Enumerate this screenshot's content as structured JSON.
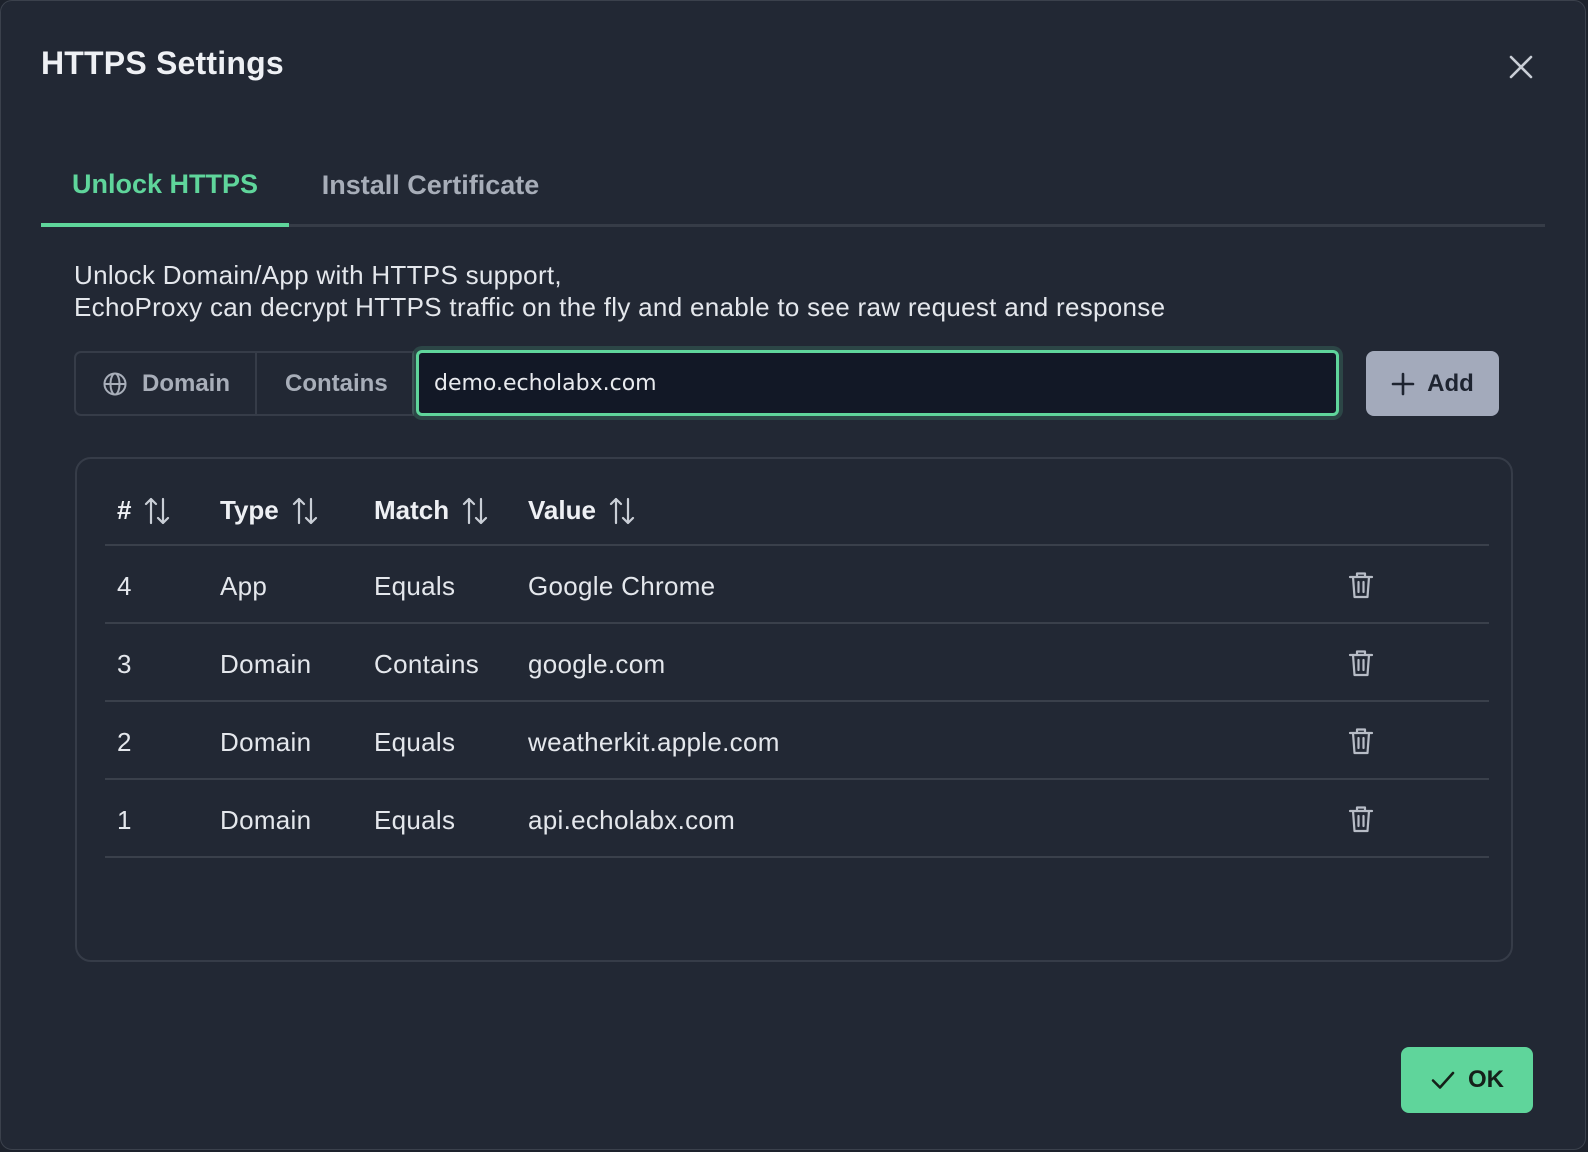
{
  "dialog": {
    "title": "HTTPS Settings"
  },
  "tabs": [
    {
      "label": "Unlock HTTPS",
      "active": true
    },
    {
      "label": "Install Certificate",
      "active": false
    }
  ],
  "description": {
    "line1": "Unlock Domain/App with HTTPS support,",
    "line2": "EchoProxy can decrypt HTTPS traffic on the fly and enable to see raw request and response"
  },
  "filter": {
    "type_label": "Domain",
    "match_label": "Contains",
    "value": "demo.echolabx.com",
    "add_label": "Add"
  },
  "table": {
    "columns": [
      "#",
      "Type",
      "Match",
      "Value"
    ],
    "rows": [
      {
        "id": "4",
        "type": "App",
        "match": "Equals",
        "value": "Google Chrome"
      },
      {
        "id": "3",
        "type": "Domain",
        "match": "Contains",
        "value": "google.com"
      },
      {
        "id": "2",
        "type": "Domain",
        "match": "Equals",
        "value": "weatherkit.apple.com"
      },
      {
        "id": "1",
        "type": "Domain",
        "match": "Equals",
        "value": "api.echolabx.com"
      }
    ]
  },
  "footer": {
    "ok_label": "OK"
  },
  "colors": {
    "accent": "#5fd59b",
    "background": "#222834",
    "add_button": "#a3aabb"
  },
  "icons": {
    "close": "close-icon",
    "globe": "globe-icon",
    "plus": "plus-icon",
    "sort": "sort-icon",
    "trash": "trash-icon",
    "check": "check-icon"
  }
}
